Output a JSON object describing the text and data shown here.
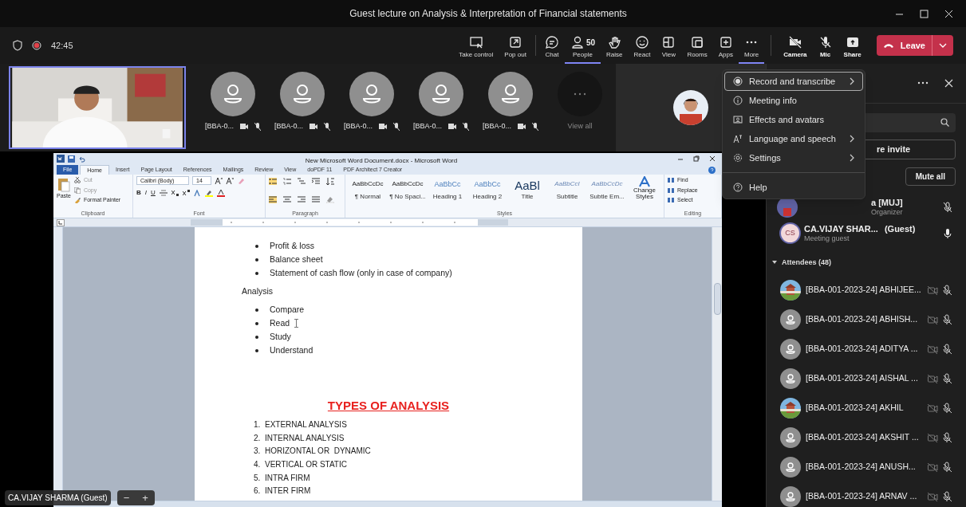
{
  "window": {
    "title": "Guest lecture on Analysis & Interpretation of Financial statements"
  },
  "meeting": {
    "timer": "42:45",
    "recording": true
  },
  "toolbar": [
    {
      "kind": "take_control",
      "label": "Take control",
      "selected": false
    },
    {
      "kind": "pop_out",
      "label": "Pop out",
      "selected": false
    },
    {
      "kind": "chat",
      "label": "Chat",
      "selected": false
    },
    {
      "kind": "people",
      "label": "People",
      "count": "50",
      "selected": true
    },
    {
      "kind": "raise",
      "label": "Raise",
      "selected": false
    },
    {
      "kind": "react",
      "label": "React",
      "selected": false
    },
    {
      "kind": "view",
      "label": "View",
      "selected": false
    },
    {
      "kind": "rooms",
      "label": "Rooms",
      "selected": false
    },
    {
      "kind": "apps",
      "label": "Apps",
      "selected": false
    },
    {
      "kind": "more",
      "label": "More",
      "selected": true
    },
    {
      "kind": "camera",
      "label": "Camera",
      "selected": false
    },
    {
      "kind": "mic",
      "label": "Mic",
      "selected": false
    },
    {
      "kind": "share",
      "label": "Share",
      "selected": false
    }
  ],
  "leave": {
    "label": "Leave"
  },
  "stage": {
    "participants": [
      {
        "name": "[BBA-0..."
      },
      {
        "name": "[BBA-0..."
      },
      {
        "name": "[BBA-0..."
      },
      {
        "name": "[BBA-0..."
      },
      {
        "name": "[BBA-0..."
      }
    ],
    "view_all": "View all",
    "presenter_label": "CA.VIJAY SHARMA (Guest)",
    "zoom_controls": [
      "−",
      "+"
    ]
  },
  "word": {
    "title": "New Microsoft Word Document.docx - Microsoft Word",
    "tabs": [
      {
        "label": "File",
        "kind": "file",
        "selected": false
      },
      {
        "label": "Home",
        "kind": "tab",
        "selected": true
      },
      {
        "label": "Insert",
        "kind": "tab",
        "selected": false
      },
      {
        "label": "Page Layout",
        "kind": "tab",
        "selected": false
      },
      {
        "label": "References",
        "kind": "tab",
        "selected": false
      },
      {
        "label": "Mailings",
        "kind": "tab",
        "selected": false
      },
      {
        "label": "Review",
        "kind": "tab",
        "selected": false
      },
      {
        "label": "View",
        "kind": "tab",
        "selected": false
      },
      {
        "label": "doPDF 11",
        "kind": "tab",
        "selected": false
      },
      {
        "label": "PDF Architect 7 Creator",
        "kind": "tab",
        "selected": false
      }
    ],
    "ribbon": {
      "paste": "Paste",
      "clipboard_items": [
        "Cut",
        "Copy",
        "Format Painter"
      ],
      "font_name": "Calibri (Body)",
      "font_size": "14",
      "format_buttons": [
        "B",
        "I",
        "U"
      ],
      "styles": [
        {
          "preview": "AaBbCcDc",
          "label": "¶ Normal",
          "kind": "body"
        },
        {
          "preview": "AaBbCcDc",
          "label": "¶ No Spaci...",
          "kind": "body"
        },
        {
          "preview": "AaBbCc",
          "label": "Heading 1",
          "kind": "heading"
        },
        {
          "preview": "AaBbCc",
          "label": "Heading 2",
          "kind": "heading"
        },
        {
          "preview": "AaBl",
          "label": "Title",
          "kind": "title"
        },
        {
          "preview": "AaBbCcI",
          "label": "Subtitle",
          "kind": "subtitle"
        },
        {
          "preview": "AaBbCcDc",
          "label": "Subtle Em...",
          "kind": "subtitle"
        }
      ],
      "change_styles": "Change Styles",
      "editing": [
        "Find",
        "Replace",
        "Select"
      ],
      "groups": [
        "Clipboard",
        "Font",
        "Paragraph",
        "Styles",
        "Editing"
      ]
    },
    "document": [
      {
        "kind": "bullet",
        "text": "Profit & loss"
      },
      {
        "kind": "bullet",
        "text": "Balance sheet"
      },
      {
        "kind": "bullet",
        "text": "Statement of cash flow (only in case of company)"
      },
      {
        "kind": "paragraph",
        "text": "Analysis"
      },
      {
        "kind": "bullet",
        "text": "Compare"
      },
      {
        "kind": "bullet",
        "text": "Read",
        "cursor": true
      },
      {
        "kind": "bullet",
        "text": "Study"
      },
      {
        "kind": "bullet",
        "text": "Understand"
      },
      {
        "kind": "heading",
        "text": "TYPES OF ANALYSIS"
      },
      {
        "kind": "numbered",
        "number": "1.",
        "text": "EXTERNAL ANALYSIS"
      },
      {
        "kind": "numbered",
        "number": "2.",
        "text": "INTERNAL ANALYSIS"
      },
      {
        "kind": "numbered",
        "number": "3.",
        "text": "HORIZONTAL OR  DYNAMIC"
      },
      {
        "kind": "numbered",
        "number": "4.",
        "text": "VERTICAL OR STATIC"
      },
      {
        "kind": "numbered",
        "number": "5.",
        "text": "INTRA FIRM"
      },
      {
        "kind": "numbered",
        "number": "6.",
        "text": "INTER FIRM"
      }
    ]
  },
  "more_menu": [
    {
      "kind": "record",
      "label": "Record and transcribe",
      "submenu": true,
      "selected": true,
      "divider_before": false
    },
    {
      "kind": "info",
      "label": "Meeting info",
      "submenu": false,
      "selected": false,
      "divider_before": false
    },
    {
      "kind": "effects",
      "label": "Effects and avatars",
      "submenu": false,
      "selected": false,
      "divider_before": false
    },
    {
      "kind": "language",
      "label": "Language and speech",
      "submenu": true,
      "selected": false,
      "divider_before": false
    },
    {
      "kind": "settings",
      "label": "Settings",
      "submenu": true,
      "selected": false,
      "divider_before": false
    },
    {
      "kind": "help",
      "label": "Help",
      "submenu": false,
      "selected": false,
      "divider_before": true
    }
  ],
  "people_panel": {
    "invite_button": "re invite",
    "mute_all": "Mute all",
    "organizer": {
      "name": "a [MUJ]",
      "role": "Organizer",
      "muted": true
    },
    "guest": {
      "initials": "CS",
      "name": "CA.VIJAY SHAR...",
      "tag": "(Guest)",
      "role": "Meeting guest",
      "muted": false
    },
    "attendees": {
      "label": "Attendees (48)",
      "expanded": true,
      "items": [
        {
          "name": "[BBA-001-2023-24] ABHIJEE..."
        },
        {
          "name": "[BBA-001-2023-24] ABHISH...",
          "kind": "default"
        },
        {
          "name": "[BBA-001-2023-24] ADITYA ...",
          "kind": "default"
        },
        {
          "name": "[BBA-001-2023-24] AISHAL ...",
          "kind": "default"
        },
        {
          "name": "[BBA-001-2023-24] AKHIL"
        },
        {
          "name": "[BBA-001-2023-24] AKSHIT ...",
          "kind": "default"
        },
        {
          "name": "[BBA-001-2023-24] ANUSH...",
          "kind": "default"
        },
        {
          "name": "[BBA-001-2023-24] ARNAV ...",
          "kind": "default"
        }
      ]
    }
  }
}
